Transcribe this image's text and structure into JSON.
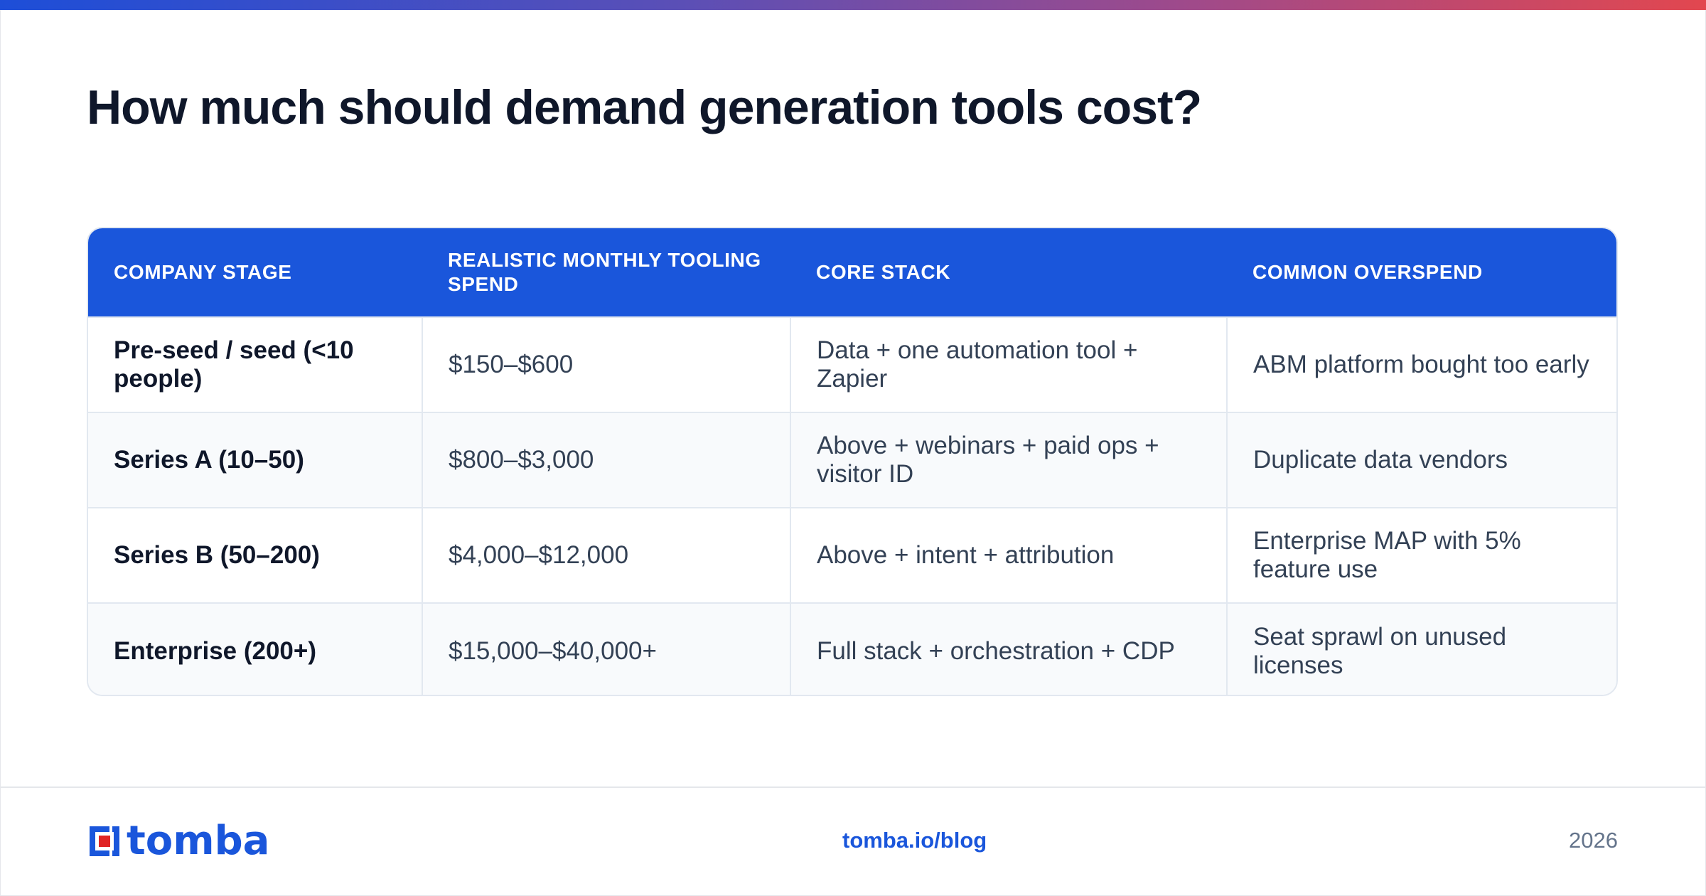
{
  "title": "How much should demand generation tools cost?",
  "table": {
    "headers": [
      "COMPANY STAGE",
      "REALISTIC MONTHLY TOOLING SPEND",
      "CORE STACK",
      "COMMON OVERSPEND"
    ],
    "rows": [
      [
        "Pre-seed / seed (<10 people)",
        "$150–$600",
        "Data + one automation tool + Zapier",
        "ABM platform bought too early"
      ],
      [
        "Series A (10–50)",
        "$800–$3,000",
        "Above + webinars + paid ops + visitor ID",
        "Duplicate data vendors"
      ],
      [
        "Series B (50–200)",
        "$4,000–$12,000",
        "Above + intent + attribution",
        "Enterprise MAP with 5% feature use"
      ],
      [
        "Enterprise (200+)",
        "$15,000–$40,000+",
        "Full stack + orchestration + CDP",
        "Seat sprawl on unused licenses"
      ]
    ]
  },
  "footer": {
    "logo_text": "tomba",
    "link": "tomba.io/blog",
    "year": "2026"
  },
  "colors": {
    "accent": "#1a56db",
    "logo_red": "#e02424",
    "gradient_start": "#1d4ed8",
    "gradient_end": "#e2474f"
  }
}
